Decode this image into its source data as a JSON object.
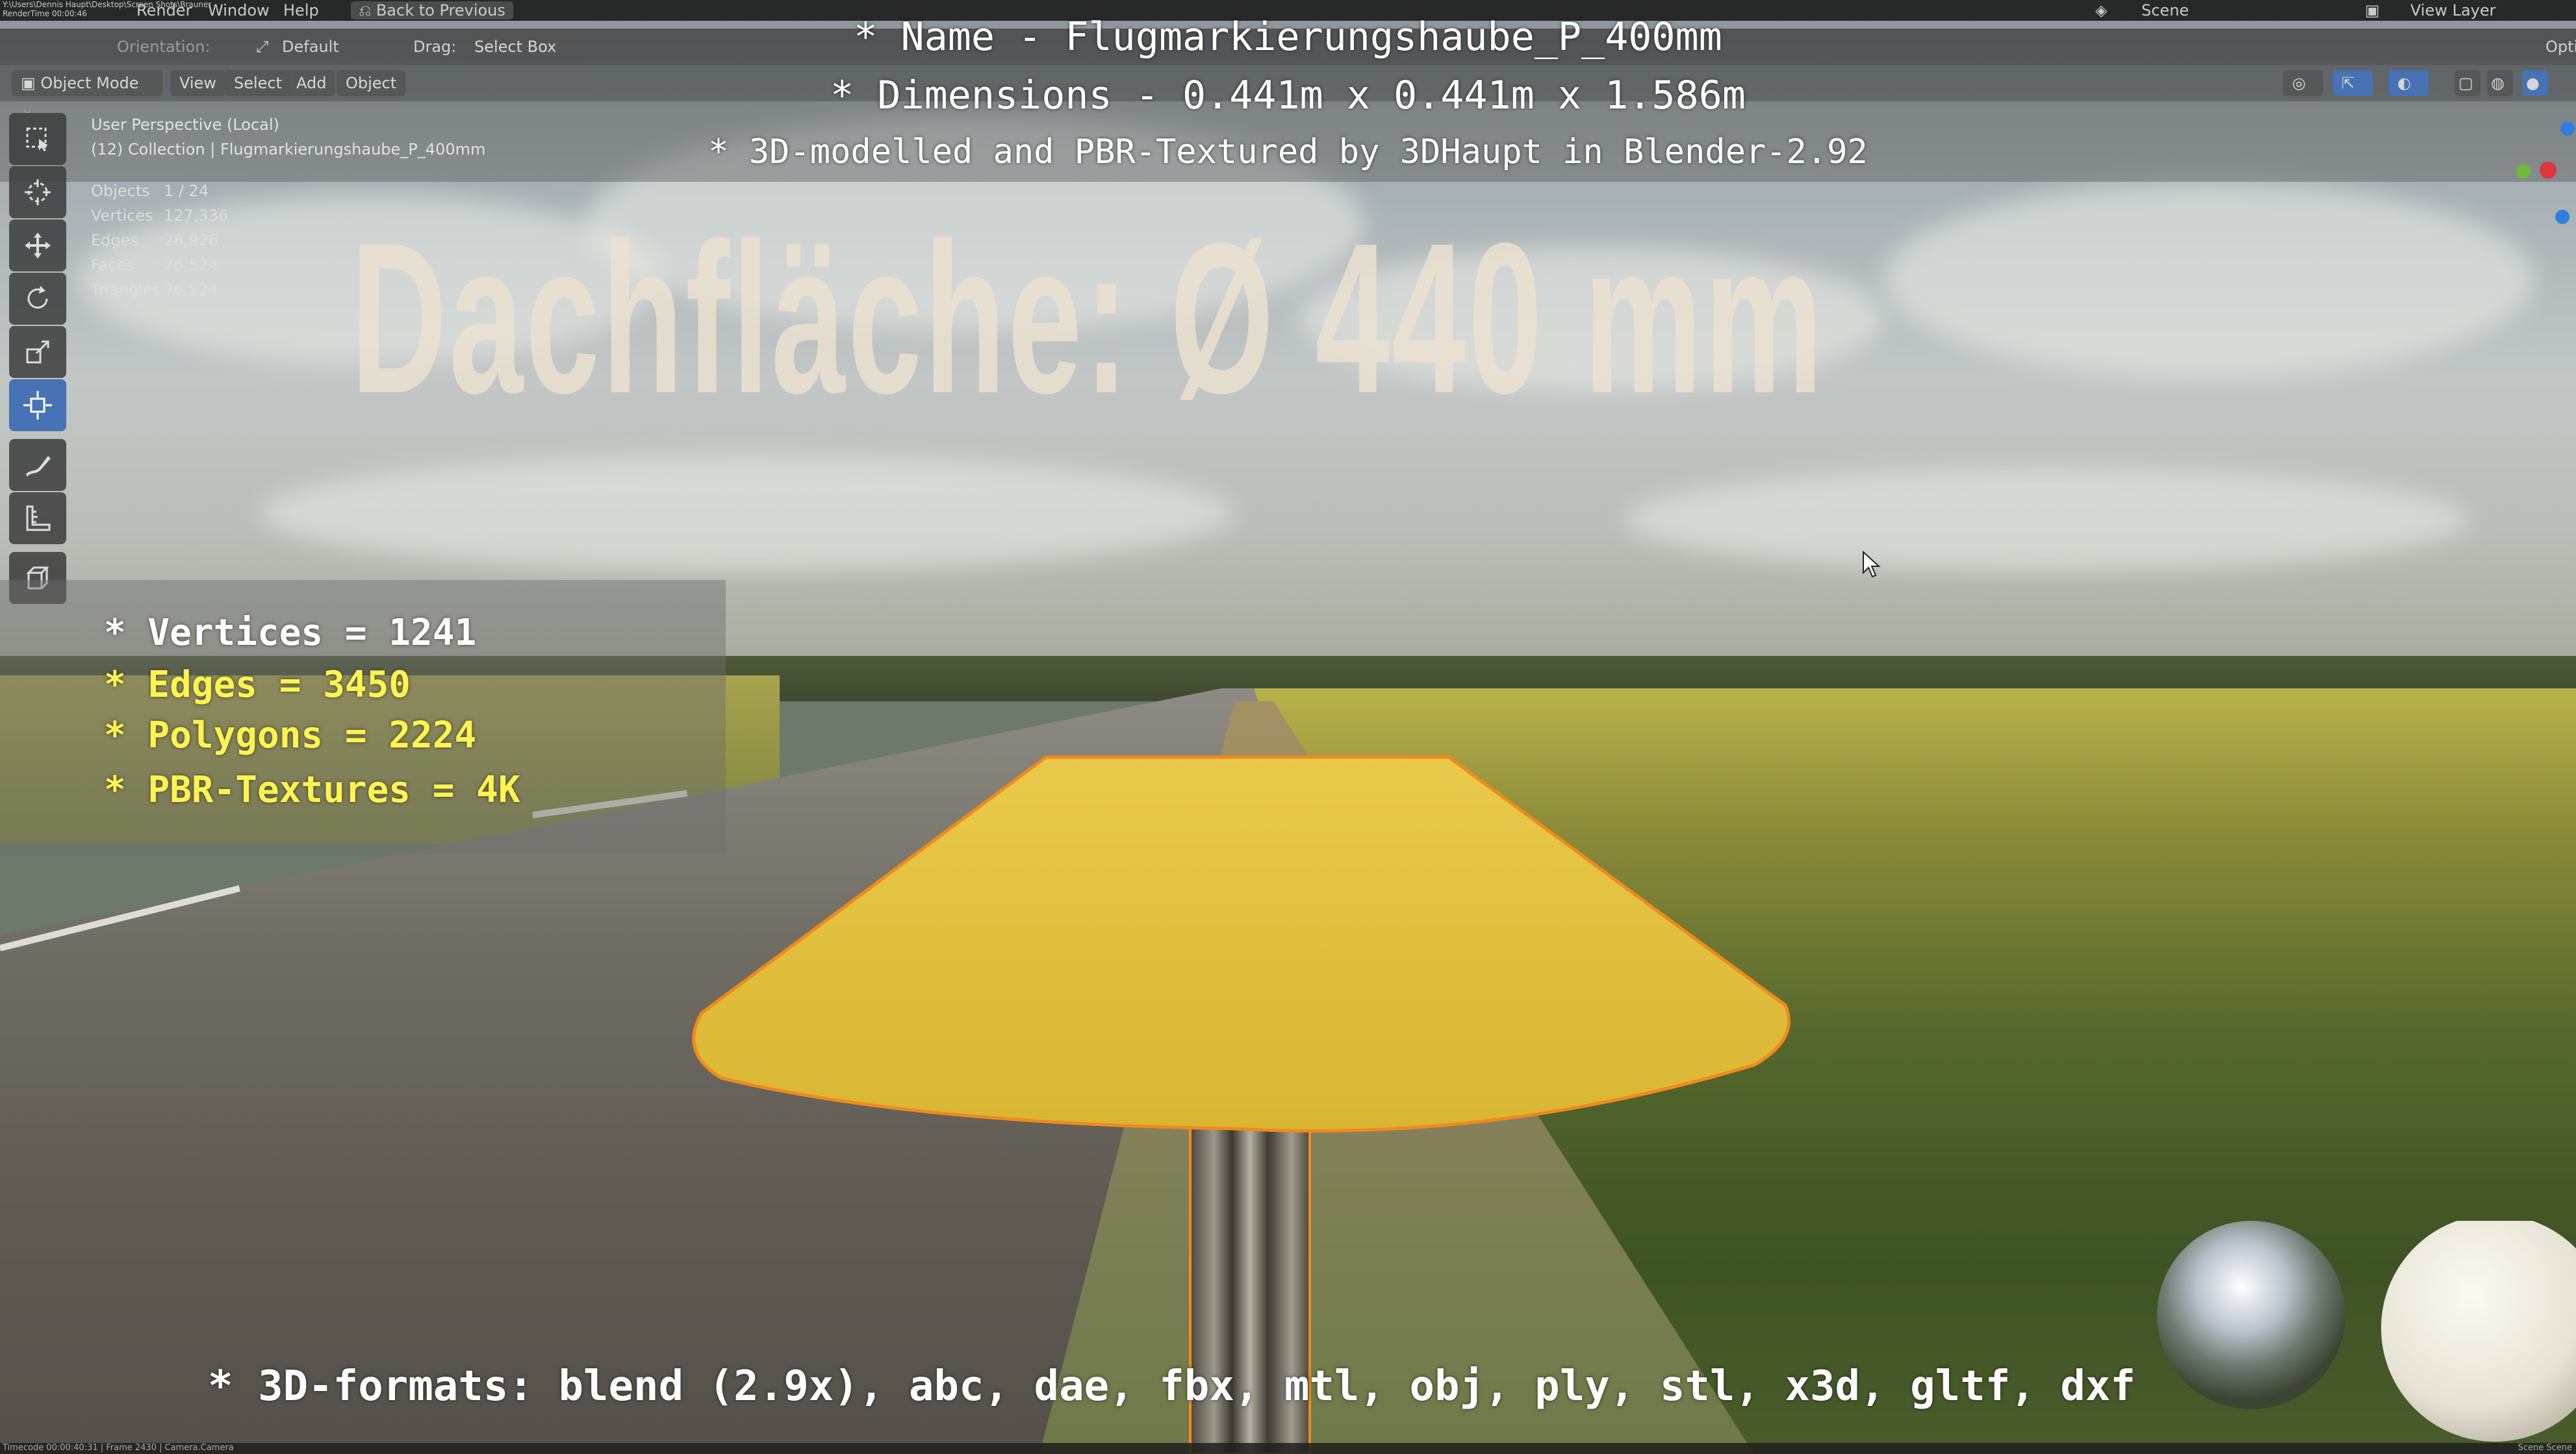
{
  "topbar": {
    "file_path": "Y:\\Users\\Dennis Haupt\\Desktop\\Screen Shots\\Brauner",
    "menu_renderstats": "RenderTime 00:00:46",
    "menu_help": "Help",
    "back_to_previous": "Back to Previous",
    "scene_label": "Scene",
    "view_layer_label": "View Layer",
    "menu_window": "Window",
    "menu_render": "Render"
  },
  "toolbar2": {
    "orientation_label": "Orientation:",
    "orientation_value": "Default",
    "drag_label": "Drag:",
    "drag_value": "Select Box",
    "options_label": "Opti"
  },
  "menubar": {
    "mode": "Object Mode",
    "view": "View",
    "select": "Select",
    "add": "Add",
    "object": "Object"
  },
  "viewport_info": {
    "perspective": "User Perspective (Local)",
    "collection": "(12) Collection | Flugmarkierungshaube_P_400mm"
  },
  "stats": [
    {
      "key": "Objects",
      "value": "1 / 24"
    },
    {
      "key": "Vertices",
      "value": "127,336"
    },
    {
      "key": "Edges",
      "value": "28,926"
    },
    {
      "key": "Faces",
      "value": "76,524"
    },
    {
      "key": "Triangles",
      "value": "76,524"
    }
  ],
  "titles": {
    "name": "* Name - Flugmarkierungshaube_P_400mm",
    "dimensions": "* Dimensions -  0.441m x 0.441m x 1.586m",
    "credit": "* 3D-modelled and PBR-Textured by 3DHaupt in Blender-2.92"
  },
  "big_text": "Dachfläche:  Ø 440 mm",
  "model_stats": [
    {
      "text": "* Vertices = 1241",
      "color": "#ffffff"
    },
    {
      "text": "* Edges = 3450",
      "color": "#fff44f"
    },
    {
      "text": "* Polygons = 2224",
      "color": "#fff44f"
    },
    {
      "text": "* PBR-Textures = 4K",
      "color": "#fff44f"
    }
  ],
  "formats": "* 3D-formats: blend (2.9x), abc, dae, fbx, mtl, obj, ply, stl, x3d, gltf, dxf",
  "statusbar": {
    "left": "Timecode 00:00:40:31 | Frame 2430 | Camera.Camera",
    "right": "Scene Scene"
  },
  "colors": {
    "cap_yellow": "#e8c332",
    "cap_outline": "#f08a1c",
    "active_tool": "#4772b3"
  },
  "icons": [
    "select-box-icon",
    "cursor-icon",
    "move-icon",
    "rotate-icon",
    "scale-icon",
    "transform-icon",
    "annotate-icon",
    "measure-icon",
    "add-cube-icon"
  ]
}
